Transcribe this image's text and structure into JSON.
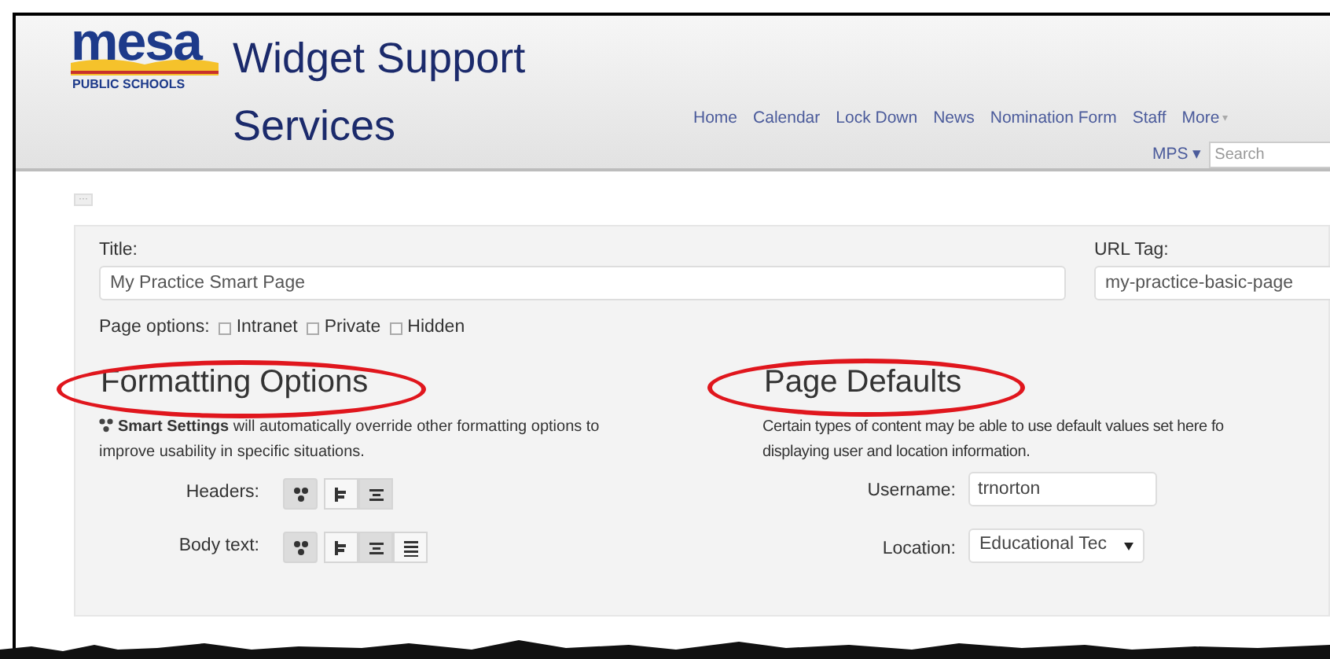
{
  "header": {
    "logo": {
      "wordmark": "mesa",
      "subtitle": "PUBLIC SCHOOLS"
    },
    "site_title": "Widget Support Services",
    "nav": [
      {
        "label": "Home"
      },
      {
        "label": "Calendar"
      },
      {
        "label": "Lock Down"
      },
      {
        "label": "News"
      },
      {
        "label": "Nomination Form"
      },
      {
        "label": "Staff"
      },
      {
        "label": "More",
        "caret": "▾"
      }
    ],
    "account": {
      "label": "MPS",
      "caret": "▾"
    },
    "search": {
      "placeholder": "Search"
    }
  },
  "toolbar": {
    "toggle_label": "···"
  },
  "form": {
    "title": {
      "label": "Title:",
      "value": "My Practice Smart Page"
    },
    "url_tag": {
      "label": "URL Tag:",
      "value": "my-practice-basic-page"
    },
    "page_options": {
      "label": "Page options:",
      "options": [
        {
          "label": "Intranet",
          "checked": false
        },
        {
          "label": "Private",
          "checked": false
        },
        {
          "label": "Hidden",
          "checked": false
        }
      ]
    },
    "formatting": {
      "heading": "Formatting Options",
      "circled": true,
      "note_lines": [
        "**Smart Settings** will automatically override other formatting options to",
        "improve usability in specific situations."
      ],
      "rows": [
        {
          "label": "Headers:",
          "buttons": [
            {
              "kind": "smart",
              "selected": true
            },
            {
              "kind": "left",
              "selected": false
            },
            {
              "kind": "center",
              "selected": true
            }
          ]
        },
        {
          "label": "Body text:",
          "buttons": [
            {
              "kind": "smart",
              "selected": true
            },
            {
              "kind": "left",
              "selected": false
            },
            {
              "kind": "center",
              "selected": true
            },
            {
              "kind": "justify",
              "selected": false
            }
          ]
        }
      ]
    },
    "defaults": {
      "heading": "Page Defaults",
      "circled": true,
      "note_lines": [
        "Certain types of content may be able to use default values set here fo",
        "displaying user and location information."
      ],
      "username": {
        "label": "Username:",
        "value": "trnorton"
      },
      "location": {
        "label": "Location:",
        "value": "Educational Tec"
      }
    }
  }
}
